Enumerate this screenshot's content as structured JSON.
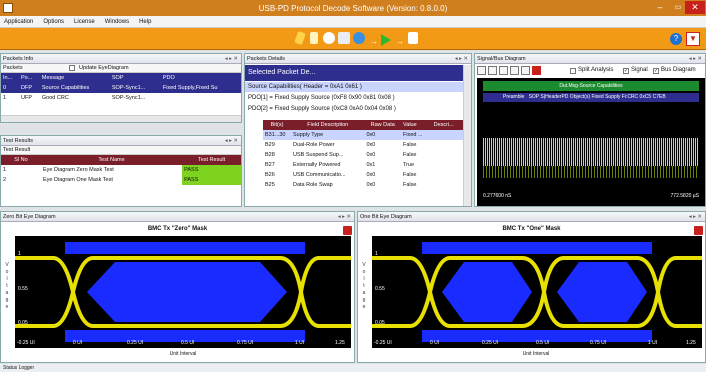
{
  "app": {
    "title": "USB-PD Protocol Decode Software (Version: 0.8.0.0)"
  },
  "window": {
    "minimize": "–",
    "maximize": "▭",
    "close": "✕"
  },
  "menu": [
    "Application",
    "Options",
    "License",
    "Windows",
    "Help"
  ],
  "packets_info": {
    "title": "Packets Info",
    "sub": "Packets",
    "update_eye": "Update EyeDiagram",
    "columns": [
      "In...",
      "Po...",
      "Message",
      "SOP",
      "PDO"
    ],
    "rows": [
      [
        "0",
        "DFP",
        "Source Capabilities",
        "SOP-Sync1...",
        "Fixed Supply,Fixed Su"
      ],
      [
        "1",
        "UFP",
        "Good CRC",
        "SOP-Sync1...",
        ""
      ]
    ]
  },
  "test_results": {
    "title": "Test Results",
    "sub": "Test Result",
    "columns": [
      "Sl No",
      "Test Name",
      "Test Result"
    ],
    "rows": [
      [
        "1",
        "Eye Diagram Zero Mask Test",
        "PASS"
      ],
      [
        "2",
        "Eye Diagram One Mask Test",
        "PASS"
      ]
    ]
  },
  "packets_details": {
    "title": "Packets Details",
    "selected": "Selected Packet De...",
    "tree": [
      "Source Capabilities( Header = 0xA1 0x61 )",
      "PDO[1] = Fixed Supply Source (0xF8 0x90 0x81 0x08 )",
      "PDO[2] = Fixed Supply Source (0xC8 0xA0 0x04 0x08 )"
    ],
    "columns": [
      "Bit(s)",
      "Field Description",
      "Raw Data",
      "Value",
      "Descri..."
    ],
    "rows": [
      [
        "B31...30",
        "Supply Type",
        "0x0",
        "Fixed ...",
        ""
      ],
      [
        "B29",
        "Dual-Role Power",
        "0x0",
        "False",
        ""
      ],
      [
        "B28",
        "USB Suspend Sup...",
        "0x0",
        "False",
        ""
      ],
      [
        "B27",
        "Externally Powered",
        "0x1",
        "True",
        ""
      ],
      [
        "B26",
        "USB Communicatio...",
        "0x0",
        "False",
        ""
      ],
      [
        "B25",
        "Data Role Swap",
        "0x0",
        "False",
        ""
      ]
    ]
  },
  "signal_bus": {
    "title": "Signal/Bus Diagram",
    "split": "Split Analysis",
    "signal": "Signal",
    "bus": "Bus Diagram",
    "header": "Dut.Msg-Source Capabilities",
    "fields": [
      "Preamble",
      "SOP S|HeaderPD Object(s) Fixed Supply Fi:CRC 0xC5 C7EB"
    ],
    "start": "0.277600 nS",
    "end": "772.5820 µS"
  },
  "eye_zero": {
    "pane": "Zero Bit Eye Diagram",
    "title": "BMC Tx \"Zero\" Mask",
    "ticks_y": [
      "1",
      "0.55",
      "0.05"
    ],
    "ticks_x": [
      "-0.25 UI",
      "0 UI",
      "0.25 UI",
      "0.5 UI",
      "0.75 UI",
      "1 UI",
      "1.25"
    ],
    "xlabel": "Unit Interval",
    "ylabel": "Voltage"
  },
  "eye_one": {
    "pane": "One Bit Eye Diagram",
    "title": "BMC Tx \"One\" Mask",
    "ticks_y": [
      "1",
      "0.55",
      "0.05"
    ],
    "ticks_x": [
      "-0.25 UI",
      "0 UI",
      "0.25 UI",
      "0.5 UI",
      "0.75 UI",
      "1 UI",
      "1.25"
    ],
    "xlabel": "Unit Interval",
    "ylabel": "Voltage"
  },
  "status": {
    "text": "Status Logger"
  },
  "colors": {
    "orange": "#f29a15",
    "navy": "#2d2e8e",
    "pass": "#7ed321",
    "eye": "#e8e000",
    "mask": "#1a2bff"
  }
}
